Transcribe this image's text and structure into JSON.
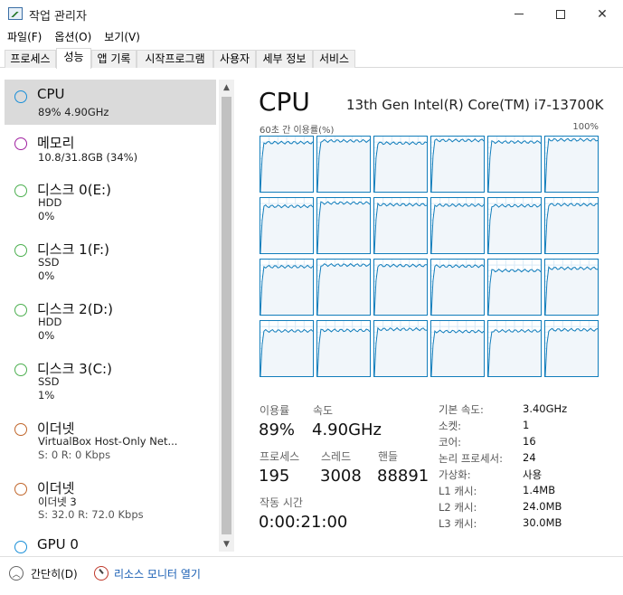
{
  "window": {
    "title": "작업 관리자"
  },
  "menu": [
    {
      "label": "파일(F)"
    },
    {
      "label": "옵션(O)"
    },
    {
      "label": "보기(V)"
    }
  ],
  "tabs": [
    {
      "label": "프로세스",
      "active": false
    },
    {
      "label": "성능",
      "active": true
    },
    {
      "label": "앱 기록",
      "active": false
    },
    {
      "label": "시작프로그램",
      "active": false
    },
    {
      "label": "사용자",
      "active": false
    },
    {
      "label": "세부 정보",
      "active": false
    },
    {
      "label": "서비스",
      "active": false
    }
  ],
  "resources": [
    {
      "title": "CPU",
      "lines": [
        "89% 4.90GHz"
      ],
      "color": "#1a8fd8",
      "selected": true
    },
    {
      "title": "메모리",
      "lines": [
        "10.8/31.8GB (34%)"
      ],
      "color": "#a020a0",
      "selected": false
    },
    {
      "title": "디스크 0(E:)",
      "lines": [
        "HDD",
        "0%"
      ],
      "color": "#4caf50",
      "selected": false
    },
    {
      "title": "디스크 1(F:)",
      "lines": [
        "SSD",
        "0%"
      ],
      "color": "#4caf50",
      "selected": false
    },
    {
      "title": "디스크 2(D:)",
      "lines": [
        "HDD",
        "0%"
      ],
      "color": "#4caf50",
      "selected": false
    },
    {
      "title": "디스크 3(C:)",
      "lines": [
        "SSD",
        "1%"
      ],
      "color": "#4caf50",
      "selected": false
    },
    {
      "title": "이더넷",
      "lines": [
        "VirtualBox Host-Only Net...",
        "S: 0 R: 0 Kbps"
      ],
      "color": "#c0662b",
      "selected": false
    },
    {
      "title": "이더넷",
      "lines": [
        "이더넷 3",
        "S: 32.0 R: 72.0 Kbps"
      ],
      "color": "#c0662b",
      "selected": false
    },
    {
      "title": "GPU 0",
      "lines": [],
      "color": "#1a8fd8",
      "selected": false
    }
  ],
  "cpu": {
    "heading": "CPU",
    "model": "13th Gen Intel(R) Core(TM) i7-13700K",
    "graph_left_label": "60초 간 이용률(%)",
    "graph_right_label": "100%",
    "graph_color": "#117dbb",
    "core_utilization_percent": [
      [
        89,
        92,
        88,
        93,
        90,
        94
      ],
      [
        85,
        91,
        88,
        87,
        86,
        88
      ],
      [
        87,
        90,
        89,
        88,
        80,
        84
      ],
      [
        82,
        83,
        85,
        81,
        82,
        84
      ]
    ],
    "stats": {
      "utilization_label": "이용률",
      "utilization_value": "89%",
      "speed_label": "속도",
      "speed_value": "4.90GHz",
      "processes_label": "프로세스",
      "processes_value": "195",
      "threads_label": "스레드",
      "threads_value": "3008",
      "handles_label": "핸들",
      "handles_value": "88891",
      "uptime_label": "작동 시간",
      "uptime_value": "0:00:21:00"
    },
    "specs": [
      {
        "label": "기본 속도:",
        "value": "3.40GHz"
      },
      {
        "label": "소켓:",
        "value": "1"
      },
      {
        "label": "코어:",
        "value": "16"
      },
      {
        "label": "논리 프로세서:",
        "value": "24"
      },
      {
        "label": "가상화:",
        "value": "사용"
      },
      {
        "label": "L1 캐시:",
        "value": "1.4MB"
      },
      {
        "label": "L2 캐시:",
        "value": "24.0MB"
      },
      {
        "label": "L3 캐시:",
        "value": "30.0MB"
      }
    ]
  },
  "footer": {
    "fewer_details": "간단히(D)",
    "resource_monitor": "리소스 모니터 열기"
  }
}
